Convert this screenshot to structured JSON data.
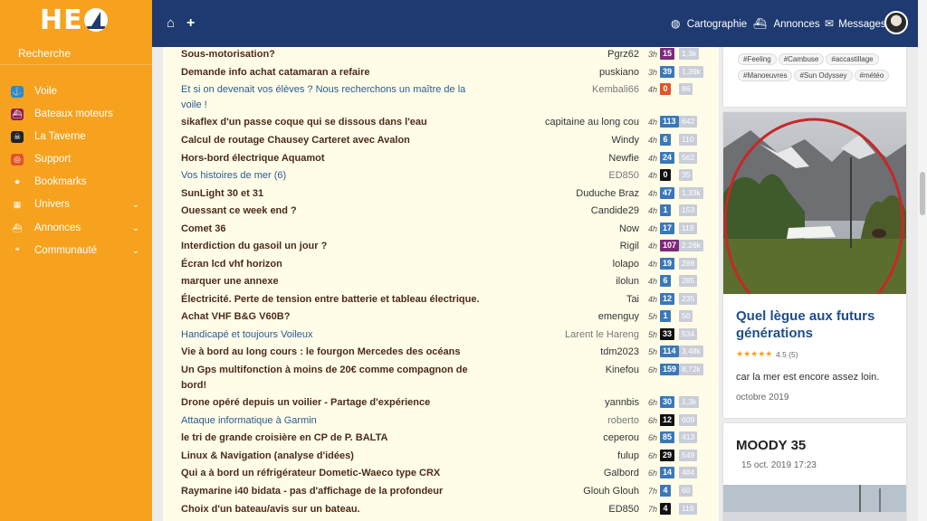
{
  "brand": {
    "logo_text": "HE"
  },
  "sidebar": {
    "search_label": "Recherche",
    "items": [
      {
        "label": "Voile",
        "icon": "anchor-icon",
        "color": "#2b8ac9"
      },
      {
        "label": "Bateaux moteurs",
        "icon": "ship-icon",
        "color": "#8e1e4d"
      },
      {
        "label": "La Taverne",
        "icon": "skull-icon",
        "color": "#222222"
      },
      {
        "label": "Support",
        "icon": "lifebuoy-icon",
        "color": "#e0542a"
      },
      {
        "label": "Bookmarks",
        "icon": "star-icon",
        "color": "#f6a21e"
      },
      {
        "label": "Univers",
        "icon": "grid-icon",
        "color": "#f6a21e",
        "chevron": "⌄"
      },
      {
        "label": "Annonces",
        "icon": "ship-icon",
        "color": "#f6a21e",
        "chevron": "⌄"
      },
      {
        "label": "Communauté",
        "icon": "chat-icon",
        "color": "#f6a21e",
        "chevron": "⌄"
      }
    ]
  },
  "topbar": {
    "home_icon": "⌂",
    "plus_icon": "+",
    "cartographie": "Cartographie",
    "annonces": "Annonces",
    "messages": "Messages"
  },
  "topics": [
    {
      "title": "Sous-motorisation?",
      "style": "bold",
      "user": "Pgrz62",
      "age": "3h",
      "rep": "15",
      "rep_color": "#7c2a7a",
      "views": "1,3k"
    },
    {
      "title": "Demande info achat catamaran a refaire",
      "style": "bold",
      "user": "puskiano",
      "age": "3h",
      "rep": "39",
      "rep_color": "#3a78b8",
      "views": "1,39k"
    },
    {
      "title": "Et si on devenait vos élèves ? Nous recherchons un maître de la voile !",
      "style": "link",
      "user": "Kembali66",
      "user_dim": true,
      "age": "4h",
      "rep": "0",
      "rep_color": "#e0542a",
      "views": "86"
    },
    {
      "title": "sikaflex d'un passe coque qui se dissous dans l'eau",
      "style": "bold",
      "user": "capitaine au long cou",
      "age": "4h",
      "rep": "113",
      "rep_color": "#3a78b8",
      "views": "642"
    },
    {
      "title": "Calcul de routage Chausey Carteret avec Avalon",
      "style": "bold",
      "user": "Windy",
      "age": "4h",
      "rep": "6",
      "rep_color": "#3a78b8",
      "views": "110"
    },
    {
      "title": "Hors-bord électrique Aquamot",
      "style": "bold",
      "user": "Newfie",
      "age": "4h",
      "rep": "24",
      "rep_color": "#3a78b8",
      "views": "562"
    },
    {
      "title": "Vos histoires de mer (6)",
      "style": "link",
      "user": "ED850",
      "user_dim": true,
      "age": "4h",
      "rep": "0",
      "rep_color": "#111111",
      "views": "35"
    },
    {
      "title": "SunLight 30 et 31",
      "style": "bold",
      "user": "Duduche Braz",
      "age": "4h",
      "rep": "47",
      "rep_color": "#3a78b8",
      "views": "1,33k"
    },
    {
      "title": "Ouessant ce week end ?",
      "style": "bold",
      "user": "Candide29",
      "age": "4h",
      "rep": "1",
      "rep_color": "#3a78b8",
      "views": "153"
    },
    {
      "title": "Comet 36",
      "style": "bold",
      "user": "Now",
      "age": "4h",
      "rep": "17",
      "rep_color": "#3a78b8",
      "views": "119"
    },
    {
      "title": "Interdiction du gasoil un jour ?",
      "style": "bold",
      "user": "Rigil",
      "age": "4h",
      "rep": "107",
      "rep_color": "#7c2a7a",
      "views": "2,26k"
    },
    {
      "title": "Écran lcd vhf horizon",
      "style": "bold",
      "user": "lolapo",
      "age": "4h",
      "rep": "19",
      "rep_color": "#3a78b8",
      "views": "288"
    },
    {
      "title": "marquer une annexe",
      "style": "bold",
      "user": "ilolun",
      "age": "4h",
      "rep": "6",
      "rep_color": "#3a78b8",
      "views": "285"
    },
    {
      "title": "Électricité. Perte de tension entre batterie et tableau électrique.",
      "style": "bold",
      "user": "Tai",
      "age": "4h",
      "rep": "12",
      "rep_color": "#3a78b8",
      "views": "235"
    },
    {
      "title": "Achat VHF B&G V60B?",
      "style": "bold",
      "user": "emenguy",
      "age": "5h",
      "rep": "1",
      "rep_color": "#3a78b8",
      "views": "50"
    },
    {
      "title": "Handicapé et toujours Voileux",
      "style": "link",
      "user": "Larent le Hareng",
      "user_dim": true,
      "age": "5h",
      "rep": "33",
      "rep_color": "#111111",
      "views": "534"
    },
    {
      "title": "Vie à bord au long cours : le fourgon Mercedes des océans",
      "style": "bold",
      "user": "tdm2023",
      "age": "5h",
      "rep": "114",
      "rep_color": "#3a78b8",
      "views": "3,48k"
    },
    {
      "title": "Un Gps multifonction à moins de 20€ comme compagnon de bord!",
      "style": "bold",
      "user": "Kinefou",
      "age": "6h",
      "rep": "159",
      "rep_color": "#3a78b8",
      "views": "8,72k"
    },
    {
      "title": "Drone opéré depuis un voilier - Partage d'expérience",
      "style": "bold",
      "user": "yannbis",
      "age": "6h",
      "rep": "30",
      "rep_color": "#3a78b8",
      "views": "1,3k"
    },
    {
      "title": "Attaque informatique à Garmin",
      "style": "link",
      "user": "roberto",
      "user_dim": true,
      "age": "6h",
      "rep": "12",
      "rep_color": "#111111",
      "views": "609"
    },
    {
      "title": "le tri de grande croisière en CP de P. BALTA",
      "style": "bold",
      "user": "ceperou",
      "age": "6h",
      "rep": "85",
      "rep_color": "#3a78b8",
      "views": "413"
    },
    {
      "title": "Linux & Navigation (analyse d'idées)",
      "style": "bold",
      "user": "fulup",
      "age": "6h",
      "rep": "29",
      "rep_color": "#111111",
      "views": "549"
    },
    {
      "title": "Qui a à bord un réfrigérateur Dometic-Waeco type CRX",
      "style": "bold",
      "user": "Galbord",
      "age": "6h",
      "rep": "14",
      "rep_color": "#3a78b8",
      "views": "484"
    },
    {
      "title": "Raymarine i40 bidata - pas d'affichage de la profondeur",
      "style": "bold",
      "user": "Glouh Glouh",
      "age": "7h",
      "rep": "4",
      "rep_color": "#3a78b8",
      "views": "60"
    },
    {
      "title": "Choix d'un bateau/avis sur un bateau.",
      "style": "bold",
      "user": "ED850",
      "age": "7h",
      "rep": "4",
      "rep_color": "#111111",
      "views": "119"
    }
  ],
  "tags": [
    "#Feeling",
    "#Cambuse",
    "#accastillage",
    "#Manoeuvres",
    "#Sun Odyssey",
    "#météo"
  ],
  "article": {
    "title": "Quel lègue aux futurs générations",
    "rating_stars": "★★★★★",
    "rating": "4.5 (5)",
    "excerpt": "car la mer est encore assez loin.",
    "date": "octobre 2019"
  },
  "boat": {
    "title": "MOODY 35",
    "date": "15 oct. 2019 17:23"
  }
}
